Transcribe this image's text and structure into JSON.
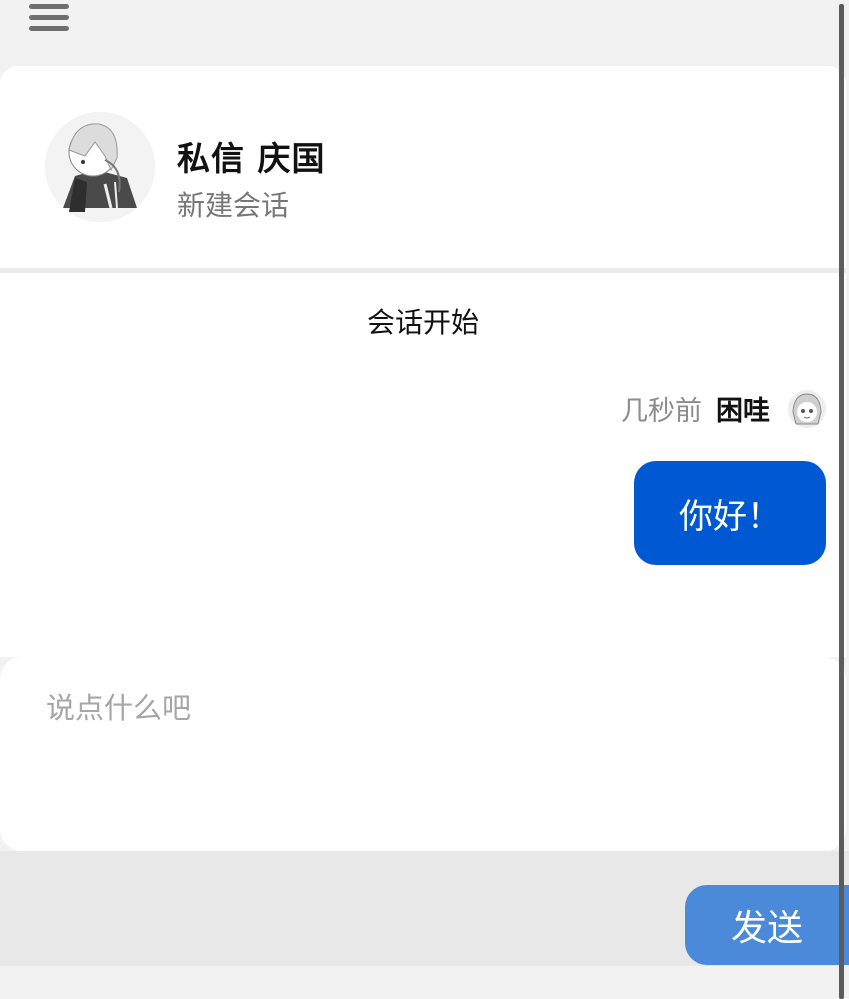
{
  "header": {
    "title": "私信 庆国",
    "subtitle": "新建会话"
  },
  "chat": {
    "session_start": "会话开始",
    "messages": [
      {
        "time": "几秒前",
        "user": "困哇",
        "text": "你好！"
      }
    ]
  },
  "composer": {
    "placeholder": "说点什么吧",
    "value": "",
    "send_label": "发送"
  },
  "icons": {
    "menu": "menu-icon",
    "contact_avatar": "avatar",
    "user_avatar": "avatar"
  },
  "colors": {
    "bubble": "#0058d2",
    "send_button": "#4a8ad9"
  }
}
